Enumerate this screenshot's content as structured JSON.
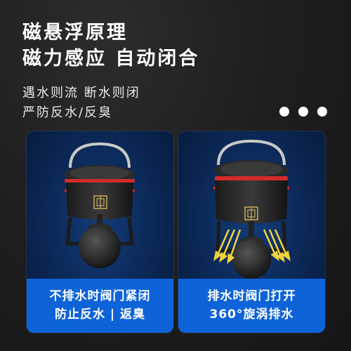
{
  "headline": {
    "line1": "磁悬浮原理",
    "line2": "磁力感应 自动闭合"
  },
  "subheading": {
    "line1": "遇水则流 断水则闭",
    "line2": "严防反水/反臭"
  },
  "pager": {
    "dots": 3
  },
  "cards": {
    "left": {
      "caption_line1": "不排水时阀门紧闭",
      "caption_line2": "防止反水 | 返臭",
      "state": "closed"
    },
    "right": {
      "caption_line1": "排水时阀门打开",
      "caption_line2": "360°旋涡排水",
      "state": "open",
      "flow_icon": "yellow-arrows-icon"
    }
  },
  "colors": {
    "accent_blue": "#0e63d8",
    "seal_red": "#d42a2a",
    "emblem_gold": "#c9a85a",
    "flow_arrow": "#f3d33a"
  }
}
